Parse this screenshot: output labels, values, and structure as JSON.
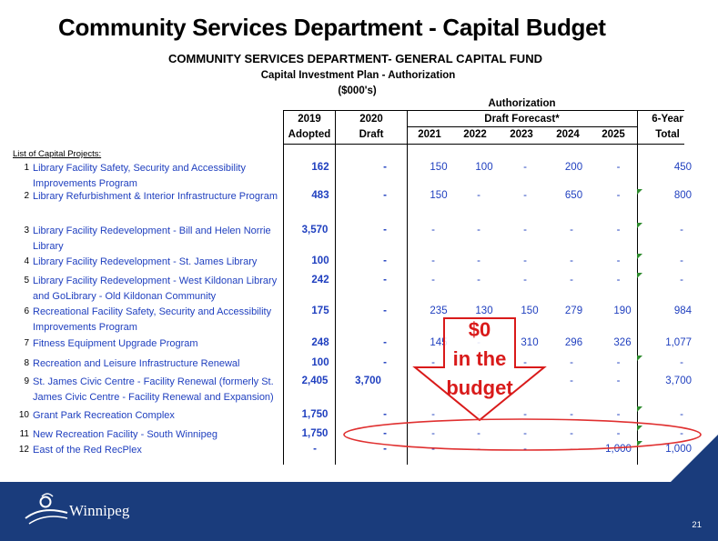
{
  "title": "Community Services Department - Capital Budget",
  "subtitle": "COMMUNITY SERVICES DEPARTMENT- GENERAL CAPITAL FUND",
  "plan_label": "Capital Investment Plan - Authorization",
  "units_label": "($000's)",
  "header": {
    "authorization": "Authorization",
    "draft_forecast": "Draft Forecast*",
    "c2019_top": "2019",
    "c2019_bottom": "Adopted",
    "c2020_top": "2020",
    "c2020_bottom": "Draft",
    "years": [
      "2021",
      "2022",
      "2023",
      "2024",
      "2025"
    ],
    "total_top": "6-Year",
    "total_bottom": "Total"
  },
  "list_label": "List of Capital Projects:",
  "projects": [
    {
      "num": "1",
      "name": "Library Facility Safety, Security and Accessibility Improvements Program",
      "adopted": "162",
      "draft": "-",
      "f2021": "150",
      "f2022": "100",
      "f2023": "-",
      "f2024": "200",
      "f2025": "-",
      "total": "450"
    },
    {
      "num": "2",
      "name": "Library Refurbishment & Interior Infrastructure Program",
      "adopted": "483",
      "draft": "-",
      "f2021": "150",
      "f2022": "-",
      "f2023": "-",
      "f2024": "650",
      "f2025": "-",
      "total": "800"
    },
    {
      "num": "3",
      "name": "Library Facility Redevelopment - Bill and Helen Norrie Library",
      "adopted": "3,570",
      "draft": "-",
      "f2021": "-",
      "f2022": "-",
      "f2023": "-",
      "f2024": "-",
      "f2025": "-",
      "total": "-"
    },
    {
      "num": "4",
      "name": "Library Facility Redevelopment - St. James Library",
      "adopted": "100",
      "draft": "-",
      "f2021": "-",
      "f2022": "-",
      "f2023": "-",
      "f2024": "-",
      "f2025": "-",
      "total": "-"
    },
    {
      "num": "5",
      "name": "Library Facility Redevelopment - West Kildonan Library and GoLibrary - Old Kildonan Community",
      "adopted": "242",
      "draft": "-",
      "f2021": "-",
      "f2022": "-",
      "f2023": "-",
      "f2024": "-",
      "f2025": "-",
      "total": "-"
    },
    {
      "num": "6",
      "name": "Recreational Facility Safety, Security and Accessibility Improvements Program",
      "adopted": "175",
      "draft": "-",
      "f2021": "235",
      "f2022": "130",
      "f2023": "150",
      "f2024": "279",
      "f2025": "190",
      "total": "984"
    },
    {
      "num": "7",
      "name": "Fitness Equipment Upgrade Program",
      "adopted": "248",
      "draft": "-",
      "f2021": "145",
      "f2022": "-",
      "f2023": "310",
      "f2024": "296",
      "f2025": "326",
      "total": "1,077"
    },
    {
      "num": "8",
      "name": "Recreation and Leisure Infrastructure Renewal",
      "adopted": "100",
      "draft": "-",
      "f2021": "-",
      "f2022": "-",
      "f2023": "-",
      "f2024": "-",
      "f2025": "-",
      "total": "-"
    },
    {
      "num": "9",
      "name": "St. James Civic Centre - Facility Renewal (formerly St. James Civic Centre - Facility Renewal and Expansion)",
      "adopted": "2,405",
      "draft": "3,700",
      "f2021": "-",
      "f2022": "-",
      "f2023": "-",
      "f2024": "-",
      "f2025": "-",
      "total": "3,700"
    },
    {
      "num": "10",
      "name": "Grant Park Recreation Complex",
      "adopted": "1,750",
      "draft": "-",
      "f2021": "-",
      "f2022": "-",
      "f2023": "-",
      "f2024": "-",
      "f2025": "-",
      "total": "-"
    },
    {
      "num": "11",
      "name": "New Recreation Facility - South Winnipeg",
      "adopted": "1,750",
      "draft": "-",
      "f2021": "-",
      "f2022": "-",
      "f2023": "-",
      "f2024": "-",
      "f2025": "-",
      "total": "-"
    },
    {
      "num": "12",
      "name": "East of the Red RecPlex",
      "adopted": "-",
      "draft": "-",
      "f2021": "-",
      "f2022": "-",
      "f2023": "-",
      "f2024": "-",
      "f2025": "1,000",
      "total": "1,000"
    }
  ],
  "callout": {
    "line1": "$0",
    "line2": "in the",
    "line3": "budget"
  },
  "footer": {
    "logo_text": "Winnipeg",
    "page_number": "21"
  },
  "colors": {
    "text_blue": "#1f3fbf",
    "callout_red": "#d91a1a",
    "footer_navy": "#1a3c7c",
    "tick_green": "#2e8b2e"
  }
}
